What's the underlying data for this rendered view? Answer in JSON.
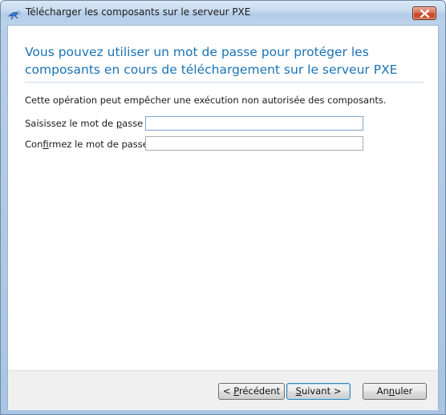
{
  "window": {
    "title": "Télécharger les composants sur le serveur PXE"
  },
  "main": {
    "heading": "Vous pouvez utiliser un mot de passe pour protéger les composants en cours de téléchargement sur le serveur PXE",
    "description": "Cette opération peut empêcher une exécution non autorisée des composants.",
    "password_label_pre": "Saisissez le mot de ",
    "password_label_mnemonic": "p",
    "password_label_post": "asse :",
    "password_value": "",
    "confirm_label_pre": "Con",
    "confirm_label_mnemonic": "f",
    "confirm_label_post": "irmez le mot de passe :",
    "confirm_value": ""
  },
  "footer": {
    "previous_pre": "< ",
    "previous_mnemonic": "P",
    "previous_post": "récédent",
    "next_mnemonic": "S",
    "next_post": "uivant >",
    "cancel_pre": "An",
    "cancel_mnemonic": "n",
    "cancel_post": "uler"
  },
  "icons": {
    "app": "satellite-dish-icon",
    "close": "close-icon"
  },
  "colors": {
    "heading": "#1a73b5",
    "close_button": "#c6452a"
  }
}
